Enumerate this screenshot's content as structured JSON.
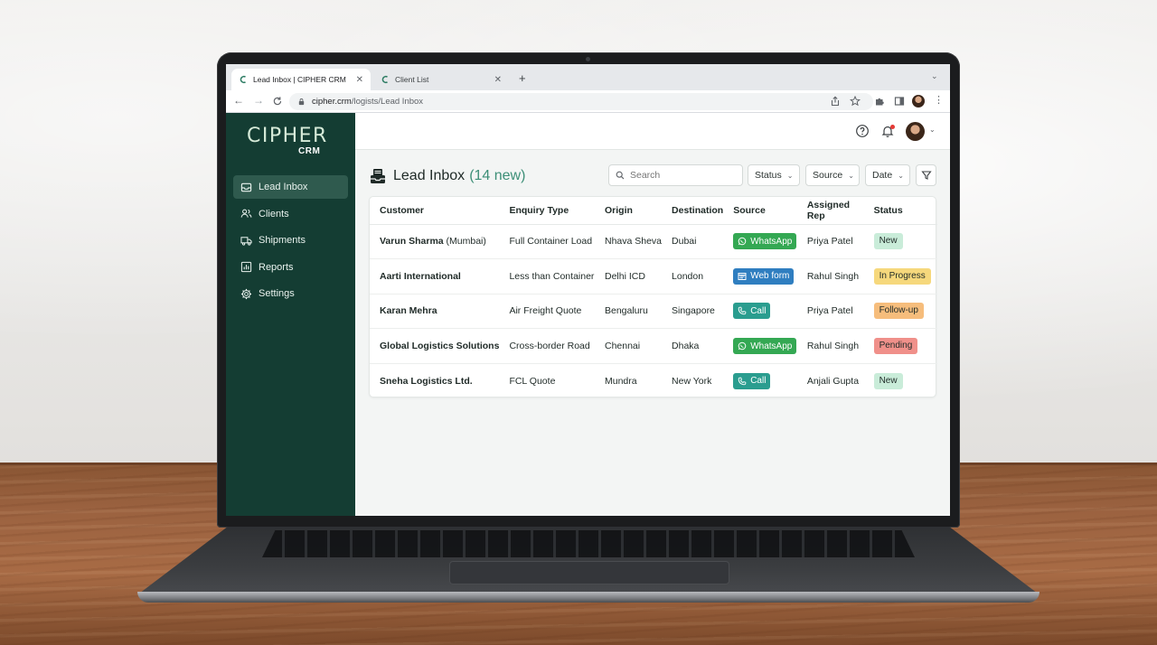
{
  "browser": {
    "tabs": [
      {
        "title": "Lead Inbox | CIPHER CRM",
        "active": true
      },
      {
        "title": "Client List",
        "active": false
      }
    ],
    "address": {
      "host": "cipher.crm",
      "path": "/logists/Lead Inbox"
    }
  },
  "app": {
    "logo": {
      "main": "CIPHER",
      "sub": "CRM"
    },
    "nav": [
      {
        "label": "Lead Inbox",
        "icon": "inbox-icon",
        "active": true
      },
      {
        "label": "Clients",
        "icon": "users-icon",
        "active": false
      },
      {
        "label": "Shipments",
        "icon": "truck-icon",
        "active": false
      },
      {
        "label": "Reports",
        "icon": "chart-icon",
        "active": false
      },
      {
        "label": "Settings",
        "icon": "gear-icon",
        "active": false
      }
    ],
    "header_icons": [
      "help-icon",
      "bell-icon",
      "avatar"
    ]
  },
  "page": {
    "title": "Lead Inbox",
    "count": "(14 new)",
    "search_placeholder": "Search",
    "filters": [
      "Status",
      "Source",
      "Date"
    ]
  },
  "table": {
    "columns": [
      "Customer",
      "Enquiry Type",
      "Origin",
      "Destination",
      "Source",
      "Assigned Rep",
      "Status"
    ],
    "rows": [
      {
        "customer": "Varun Sharma",
        "customer_sub": "(Mumbai)",
        "enquiry": "Full Container Load",
        "origin": "Nhava Sheva",
        "destination": "Dubai",
        "source": "WhatsApp",
        "rep": "Priya Patel",
        "status": "New"
      },
      {
        "customer": "Aarti International",
        "customer_sub": "",
        "enquiry": "Less than Container",
        "origin": "Delhi ICD",
        "destination": "London",
        "source": "Web form",
        "rep": "Rahul Singh",
        "status": "In Progress"
      },
      {
        "customer": "Karan Mehra",
        "customer_sub": "",
        "enquiry": "Air Freight Quote",
        "origin": "Bengaluru",
        "destination": "Singapore",
        "source": "Call",
        "rep": "Priya Patel",
        "status": "Follow-up"
      },
      {
        "customer": "Global Logistics Solutions",
        "customer_sub": "",
        "enquiry": "Cross-border Road",
        "origin": "Chennai",
        "destination": "Dhaka",
        "source": "WhatsApp",
        "rep": "Rahul Singh",
        "status": "Pending"
      },
      {
        "customer": "Sneha Logistics Ltd.",
        "customer_sub": "",
        "enquiry": "FCL Quote",
        "origin": "Mundra",
        "destination": "New York",
        "source": "Call",
        "rep": "Anjali Gupta",
        "status": "New"
      }
    ]
  },
  "colors": {
    "sidebar": "#143d33",
    "accent": "#3d8f77",
    "source": {
      "WhatsApp": "#34a853",
      "Web form": "#2f7ec0",
      "Call": "#2a9d8f"
    },
    "status": {
      "New": "#c9ecd9",
      "In Progress": "#f6d87c",
      "Follow-up": "#f6bd7c",
      "Pending": "#f0908a"
    }
  }
}
